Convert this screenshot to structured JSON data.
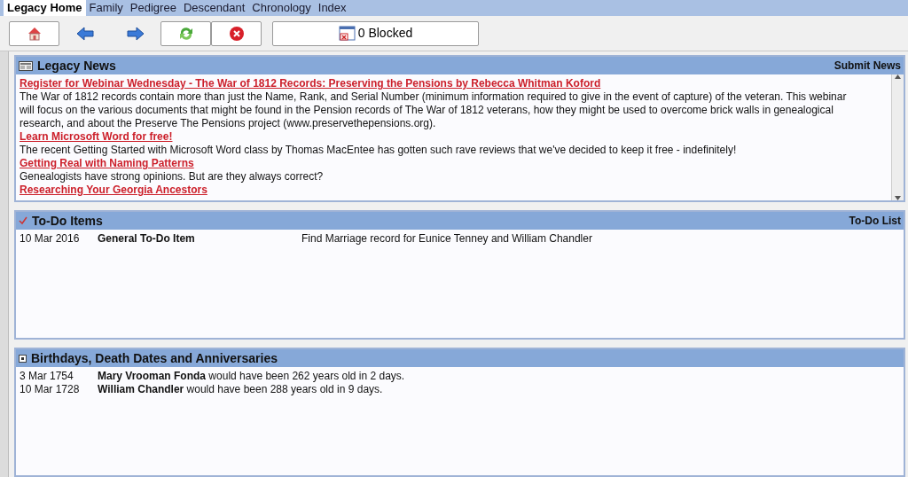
{
  "tabs": [
    {
      "label": "Legacy Home",
      "selected": true
    },
    {
      "label": "Family",
      "selected": false
    },
    {
      "label": "Pedigree",
      "selected": false
    },
    {
      "label": "Descendant",
      "selected": false
    },
    {
      "label": "Chronology",
      "selected": false
    },
    {
      "label": "Index",
      "selected": false
    }
  ],
  "toolbar": [
    {
      "kind": "home"
    },
    {
      "kind": "back"
    },
    {
      "kind": "forward"
    },
    {
      "kind": "refresh"
    },
    {
      "kind": "stop"
    },
    {
      "kind": "blocked",
      "label": "0 Blocked"
    }
  ],
  "news": {
    "title": "Legacy News",
    "action": "Submit News",
    "items": [
      {
        "kind": "link",
        "text": "Register for Webinar Wednesday - The War of 1812 Records: Preserving the Pensions by Rebecca Whitman Koford"
      },
      {
        "kind": "text",
        "text": "The War of 1812 records contain more than just the Name, Rank, and Serial Number (minimum information required to give in the event of capture) of the veteran. This webinar will focus on the various documents that might be found in the Pension records of The War of 1812 veterans, how they might be used to overcome brick walls in genealogical research, and about the Preserve The Pensions project (www.preservethepensions.org)."
      },
      {
        "kind": "link",
        "text": "Learn Microsoft Word for free!"
      },
      {
        "kind": "text",
        "text": "The recent Getting Started with Microsoft Word class by Thomas MacEntee has gotten such rave reviews that we've decided to keep it free - indefinitely!"
      },
      {
        "kind": "link",
        "text": "Getting Real with Naming Patterns"
      },
      {
        "kind": "text",
        "text": "Genealogists have strong opinions. But are they always correct?"
      },
      {
        "kind": "link",
        "text": "Researching Your Georgia Ancestors"
      }
    ]
  },
  "todo": {
    "title": "To-Do Items",
    "action": "To-Do List",
    "rows": [
      {
        "date": "10 Mar 2016",
        "type": "General To-Do Item",
        "description": "Find Marriage record for Eunice Tenney and William Chandler"
      }
    ]
  },
  "anniversaries": {
    "title": "Birthdays, Death Dates and Anniversaries",
    "rows": [
      {
        "date": "3 Mar 1754",
        "text": "**Mary Vrooman Fonda** would have been 262 years old in 2 days."
      },
      {
        "date": "10 Mar 1728",
        "text": "**William Chandler** would have been 288 years old in 9 days."
      }
    ]
  }
}
